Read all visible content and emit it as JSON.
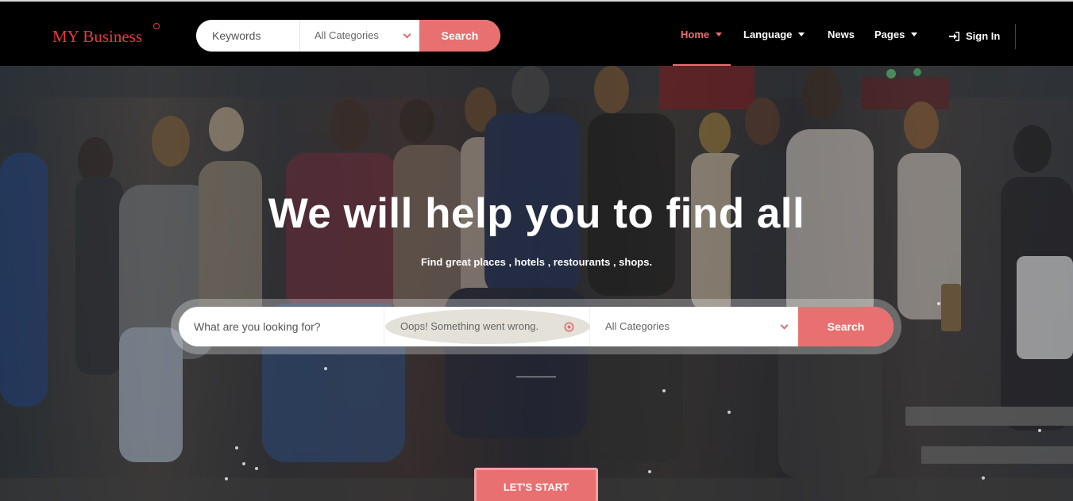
{
  "colors": {
    "accent": "#e87070",
    "brand": "#e8383f",
    "header_bg": "#000000"
  },
  "header": {
    "brand_name": "MY Business",
    "search": {
      "keywords_placeholder": "Keywords",
      "category_value": "All Categories",
      "button_label": "Search"
    },
    "nav": {
      "home": "Home",
      "language": "Language",
      "news": "News",
      "pages": "Pages",
      "sign_in": "Sign In"
    }
  },
  "hero": {
    "title": "We will help you to find all",
    "subtitle": "Find great places , hotels , restourants , shops.",
    "search": {
      "what_placeholder": "What are you looking for?",
      "location_error": "Oops! Something went wrong.",
      "category_value": "All Categories",
      "button_label": "Search"
    },
    "cta_label": "LET'S START"
  }
}
